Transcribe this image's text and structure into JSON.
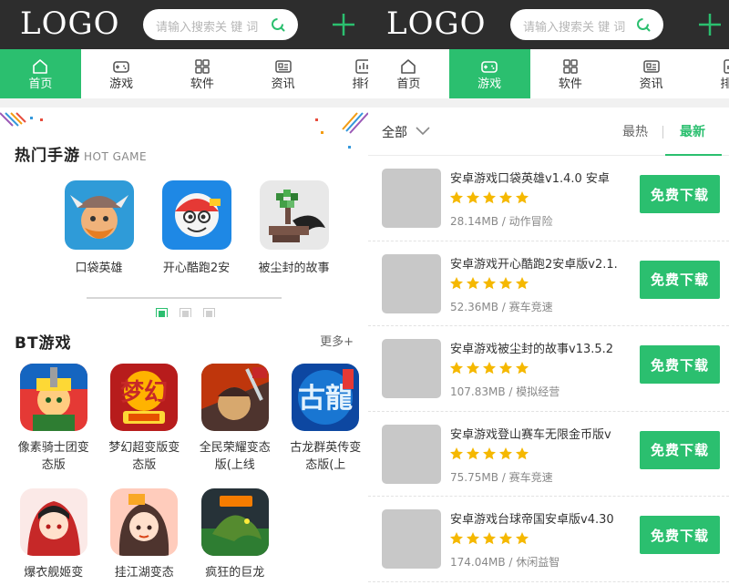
{
  "colors": {
    "brand_green": "#2bbf6f",
    "header_bg": "#2d2d2d",
    "star": "#f5b800",
    "placeholder_thumb": "#c8c8c8"
  },
  "header": {
    "logo": "LOGO",
    "search_placeholder": "请输入搜索关 键 词"
  },
  "nav": [
    {
      "label": "首页",
      "icon": "home-icon"
    },
    {
      "label": "游戏",
      "icon": "gamepad-icon"
    },
    {
      "label": "软件",
      "icon": "apps-grid-icon"
    },
    {
      "label": "资讯",
      "icon": "news-icon"
    },
    {
      "label": "排行",
      "icon": "ranking-icon"
    }
  ],
  "left": {
    "active_tab": 0,
    "hot": {
      "title": "热门手游",
      "subtitle": "HOT GAME",
      "games": [
        {
          "name": "口袋英雄",
          "icon": "viking-hero-icon"
        },
        {
          "name": "开心酷跑2安",
          "icon": "robot-runner-icon"
        },
        {
          "name": "被尘封的故事",
          "icon": "pixel-tree-icon"
        }
      ],
      "pages": 3,
      "current_page": 0
    },
    "bt": {
      "title": "BT游戏",
      "more": "更多+",
      "games": [
        {
          "name": "像素骑士团变态版",
          "icon": "pixel-knight-icon"
        },
        {
          "name": "梦幻超变版变态版",
          "icon": "menghuan-icon"
        },
        {
          "name": "全民荣耀变态版(上线",
          "icon": "warrior-icon"
        },
        {
          "name": "古龙群英传变态版(上",
          "icon": "gulong-icon"
        },
        {
          "name": "爆衣舰姬变",
          "icon": "anime-girl-icon"
        },
        {
          "name": "挂江湖变态",
          "icon": "jianghu-girl-icon"
        },
        {
          "name": "疯狂的巨龙",
          "icon": "dragon-icon"
        }
      ]
    }
  },
  "right": {
    "active_tab": 1,
    "filter": {
      "all": "全部",
      "hot": "最热",
      "new": "最新"
    },
    "download_label": "免费下载",
    "apps": [
      {
        "title": "安卓游戏口袋英雄v1.4.0 安卓",
        "rating": 5,
        "size": "28.14MB",
        "category": "动作冒险"
      },
      {
        "title": "安卓游戏开心酷跑2安卓版v2.1.",
        "rating": 5,
        "size": "52.36MB",
        "category": "赛车竞速"
      },
      {
        "title": "安卓游戏被尘封的故事v13.5.2",
        "rating": 5,
        "size": "107.83MB",
        "category": "模拟经营"
      },
      {
        "title": "安卓游戏登山赛车无限金币版v",
        "rating": 5,
        "size": "75.75MB",
        "category": "赛车竞速"
      },
      {
        "title": "安卓游戏台球帝国安卓版v4.30",
        "rating": 5,
        "size": "174.04MB",
        "category": "休闲益智"
      }
    ]
  }
}
